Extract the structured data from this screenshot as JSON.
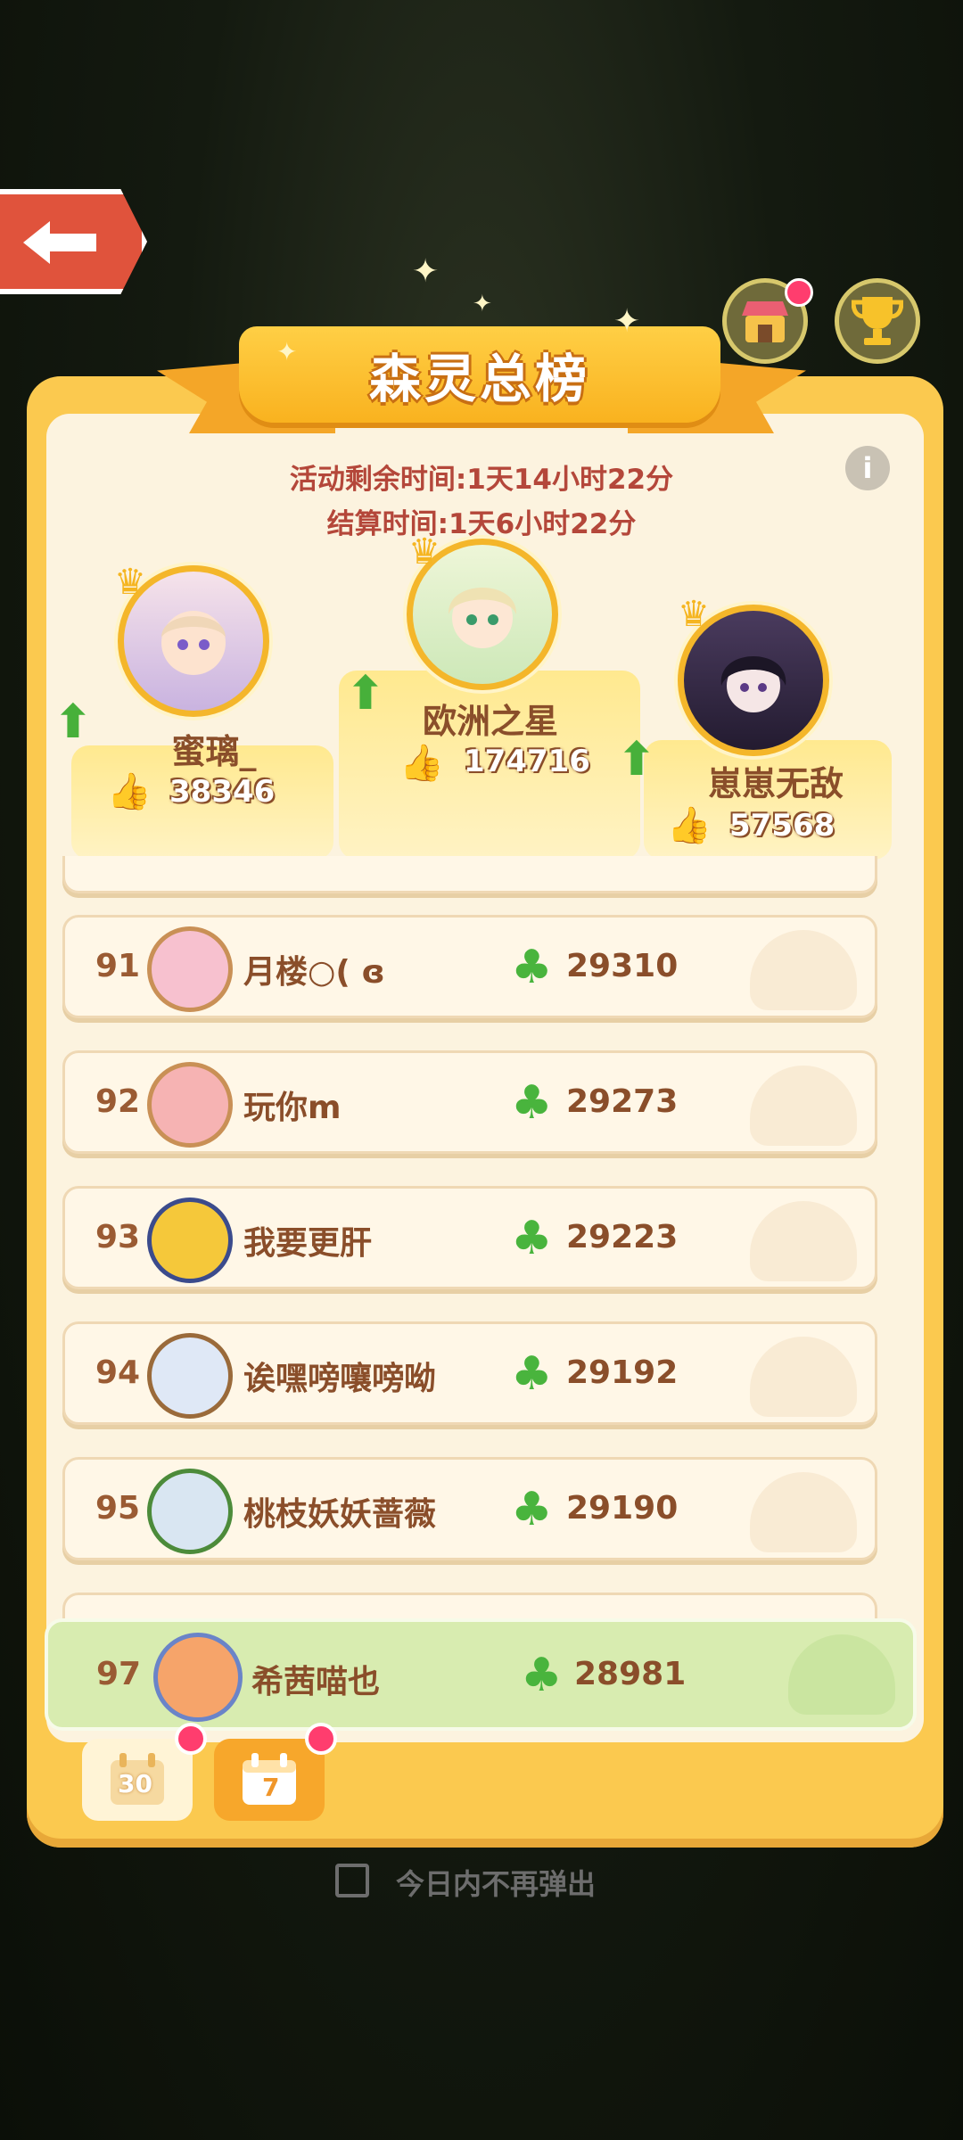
{
  "title": "森灵总榜",
  "activity_remaining": "活动剩余时间:1天14小时22分",
  "settlement_time": "结算时间:1天6小时22分",
  "podium": [
    {
      "place": "second",
      "name": "蜜璃_",
      "likes": "38346"
    },
    {
      "place": "first",
      "name": "欧洲之星",
      "likes": "174716"
    },
    {
      "place": "third",
      "name": "崽崽无敌",
      "likes": "57568"
    }
  ],
  "rows": [
    {
      "rank": "91",
      "name": "月楼○( ɞ",
      "score": "29310"
    },
    {
      "rank": "92",
      "name": "玩你m",
      "score": "29273"
    },
    {
      "rank": "93",
      "name": "我要更肝",
      "score": "29223"
    },
    {
      "rank": "94",
      "name": "诶嘿嗙嚷嗙呦",
      "score": "29192"
    },
    {
      "rank": "95",
      "name": "桃枝妖妖蔷薇",
      "score": "29190"
    }
  ],
  "me": {
    "rank": "97",
    "name": "希茜喵也",
    "score": "28981"
  },
  "tabs": [
    {
      "label": "30"
    },
    {
      "label": "7"
    }
  ],
  "dont_show_today": "今日内不再弹出",
  "icons": {
    "back": "back-arrow-icon",
    "shop": "shop-icon",
    "trophy": "trophy-icon",
    "info": "info-icon",
    "clover": "clover-icon",
    "thumb": "thumb-up-icon",
    "crown": "crown-icon"
  },
  "colors": {
    "accent": "#f9b21f",
    "clover": "#49b43d",
    "text_brown": "#8a4e2a",
    "time_red": "#b4473a"
  }
}
